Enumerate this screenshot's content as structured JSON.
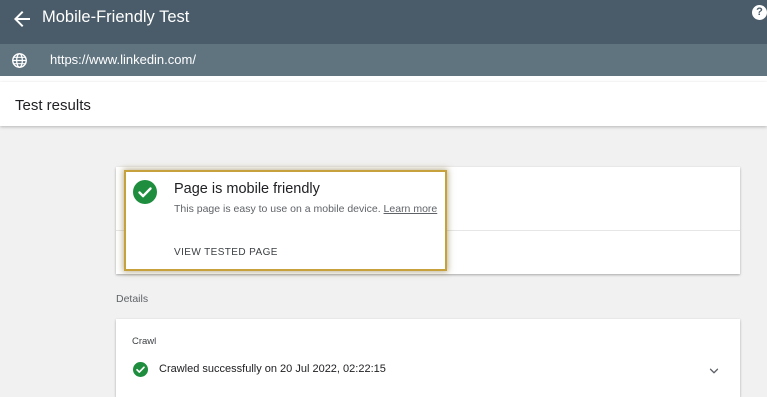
{
  "header": {
    "title": "Mobile-Friendly Test",
    "help_label": "?"
  },
  "url_bar": {
    "url": "https://www.linkedin.com/"
  },
  "results": {
    "title": "Test results"
  },
  "result_card": {
    "title": "Page is mobile friendly",
    "description": "This page is easy to use on a mobile device.",
    "learn_more": "Learn more",
    "view_button": "VIEW TESTED PAGE"
  },
  "details": {
    "label": "Details",
    "crawl": {
      "title": "Crawl",
      "status": "Crawled successfully on 20 Jul 2022, 02:22:15"
    }
  },
  "colors": {
    "topbar": "#4a5c69",
    "urlbar": "#607480",
    "success": "#1e8e3e",
    "highlight": "#c7a23c"
  },
  "icons": {
    "back": "arrow-back-icon",
    "help": "help-icon",
    "globe": "globe-icon",
    "check": "check-circle-icon",
    "expand": "chevron-down-icon"
  }
}
